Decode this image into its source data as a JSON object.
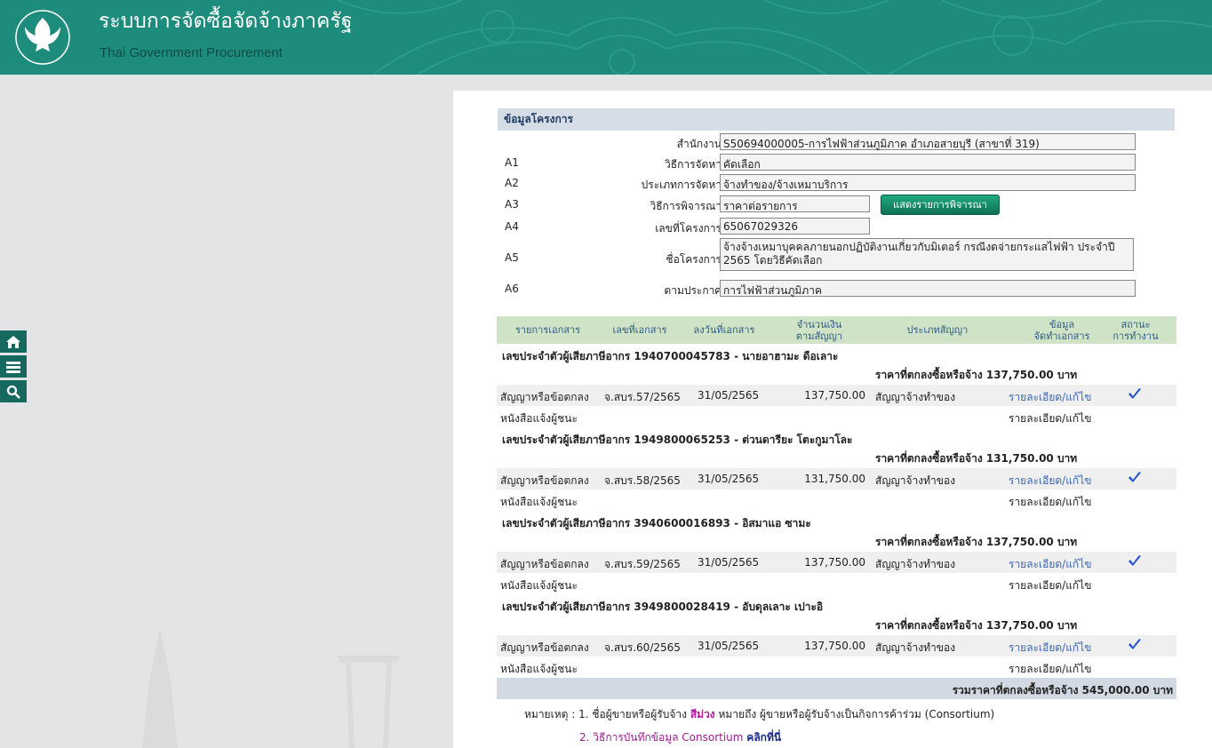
{
  "header": {
    "title": "ระบบการจัดซื้อจัดจ้างภาครัฐ",
    "subtitle": "Thai Government Procurement",
    "logo_text": "กรมบัญชีกลาง",
    "bg_color": "#1e8c7c"
  },
  "side_tools": [
    {
      "icon": "home-icon"
    },
    {
      "icon": "menu-icon"
    },
    {
      "icon": "search-icon"
    }
  ],
  "project": {
    "section_title": "ข้อมูลโครงการ",
    "fields": [
      {
        "code": "",
        "label": "สำนักงาน",
        "value": "S50694000005-การไฟฟ้าส่วนภูมิภาค อำเภอสายบุรี (สาขาที่ 319)"
      },
      {
        "code": "A1",
        "label": "วิธีการจัดหา",
        "value": "คัดเลือก"
      },
      {
        "code": "A2",
        "label": "ประเภทการจัดหา",
        "value": "จ้างทำของ/จ้างเหมาบริการ"
      },
      {
        "code": "A3",
        "label": "วิธีการพิจารณา",
        "value": "ราคาต่อรายการ"
      },
      {
        "code": "A4",
        "label": "เลขที่โครงการ",
        "value": "65067029326"
      },
      {
        "code": "A5",
        "label": "ชื่อโครงการ",
        "value": "จ้างจ้างเหมาบุคคลภายนอกปฏิบัติงานเกี่ยวกับมิเตอร์ กรณีงดจ่ายกระแสไฟฟ้า ประจำปี 2565 โดยวิธีคัดเลือก"
      },
      {
        "code": "A6",
        "label": "ตามประกาศ",
        "value": "การไฟฟ้าส่วนภูมิภาค"
      }
    ],
    "consider_button": "แสดงรายการพิจารณา"
  },
  "table": {
    "headers": [
      "รายการเอกสาร",
      "เลขที่เอกสาร",
      "ลงวันที่เอกสาร",
      "จำนวนเงิน\nตามสัญญา",
      "ประเภทสัญญา",
      "ข้อมูล\nจัดทำเอกสาร",
      "สถานะ\nการทำงาน"
    ],
    "groups": [
      {
        "vendor": "เลขประจำตัวผู้เสียภาษีอากร 1940700045783 - นายอาฮามะ ดือเลาะ",
        "price": "ราคาที่ตกลงซื้อหรือจ้าง 137,750.00 บาท",
        "contract": {
          "doc": "สัญญาหรือข้อตกลง",
          "no": "จ.สบร.57/2565",
          "date": "31/05/2565",
          "amount": "137,750.00",
          "type": "สัญญาจ้างทำของ",
          "action": "รายละเอียด/แก้ไข"
        },
        "notice": {
          "doc": "หนังสือแจ้งผู้ชนะ",
          "action": "รายละเอียด/แก้ไข"
        }
      },
      {
        "vendor": "เลขประจำตัวผู้เสียภาษีอากร 1949800065253 - ต่วนดารียะ โตะกูมาโละ",
        "price": "ราคาที่ตกลงซื้อหรือจ้าง 131,750.00 บาท",
        "contract": {
          "doc": "สัญญาหรือข้อตกลง",
          "no": "จ.สบร.58/2565",
          "date": "31/05/2565",
          "amount": "131,750.00",
          "type": "สัญญาจ้างทำของ",
          "action": "รายละเอียด/แก้ไข"
        },
        "notice": {
          "doc": "หนังสือแจ้งผู้ชนะ",
          "action": "รายละเอียด/แก้ไข"
        }
      },
      {
        "vendor": "เลขประจำตัวผู้เสียภาษีอากร 3940600016893 - อิสมาแอ ซามะ",
        "price": "ราคาที่ตกลงซื้อหรือจ้าง 137,750.00 บาท",
        "contract": {
          "doc": "สัญญาหรือข้อตกลง",
          "no": "จ.สบร.59/2565",
          "date": "31/05/2565",
          "amount": "137,750.00",
          "type": "สัญญาจ้างทำของ",
          "action": "รายละเอียด/แก้ไข"
        },
        "notice": {
          "doc": "หนังสือแจ้งผู้ชนะ",
          "action": "รายละเอียด/แก้ไข"
        }
      },
      {
        "vendor": "เลขประจำตัวผู้เสียภาษีอากร 3949800028419 - อับดุลเลาะ เปาะอิ",
        "price": "ราคาที่ตกลงซื้อหรือจ้าง 137,750.00 บาท",
        "contract": {
          "doc": "สัญญาหรือข้อตกลง",
          "no": "จ.สบร.60/2565",
          "date": "31/05/2565",
          "amount": "137,750.00",
          "type": "สัญญาจ้างทำของ",
          "action": "รายละเอียด/แก้ไข"
        },
        "notice": {
          "doc": "หนังสือแจ้งผู้ชนะ",
          "action": "รายละเอียด/แก้ไข"
        }
      }
    ],
    "total": "รวมราคาที่ตกลงซื้อหรือจ้าง 545,000.00 บาท"
  },
  "notes": {
    "label": "หมายเหตุ :",
    "line1_prefix": "1. ชื่อผู้ขายหรือผู้รับจ้าง",
    "line1_color_word": "สีม่วง",
    "line1_suffix": "หมายถึง ผู้ขายหรือผู้รับจ้างเป็นกิจการค้าร่วม (Consortium)",
    "line2_prefix": "2.",
    "line2_text": "วิธีการบันทึกข้อมูล Consortium",
    "line2_link": "คลิกที่นี่"
  }
}
